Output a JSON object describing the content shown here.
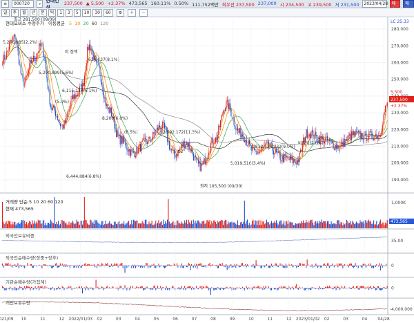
{
  "toolbar": {
    "symbol_code": "000720",
    "stock_name": "현대건설",
    "buy_label": "매수",
    "sell_label": "매도",
    "quotes": [
      {
        "text": "237,500",
        "dir": "up"
      },
      {
        "text": "▲ 5,500",
        "dir": "up"
      },
      {
        "text": "+2.37%",
        "dir": "up"
      },
      {
        "text": "473,565",
        "dir": "nt"
      },
      {
        "text": "160.11%",
        "dir": "nt"
      },
      {
        "text": "0.50%",
        "dir": "nt"
      },
      {
        "text": "111,752백만",
        "dir": "nt"
      },
      {
        "text": "최우선 237,500",
        "dir": "up"
      },
      {
        "text": "237,000",
        "dir": "dn"
      },
      {
        "text": "시 234,500",
        "dir": "up"
      },
      {
        "text": "고 239,500",
        "dir": "up"
      },
      {
        "text": "저 231,500",
        "dir": "dn"
      }
    ],
    "date_value": "2023/04/28",
    "period_buttons": [
      "일",
      "주",
      "월",
      "년",
      "분",
      "틱",
      "1",
      "3",
      "5",
      "10",
      "30",
      "60"
    ]
  },
  "price_pane": {
    "legend_title": "현대모비스 수정주가",
    "ma_label": "이동평균",
    "ma_periods": [
      "5",
      "10",
      "20",
      "60",
      "120"
    ],
    "ma_colors": [
      "#d4a000",
      "#ff7a00",
      "#2aa54a",
      "#333333",
      "#8a8a8a"
    ],
    "annotations": [
      {
        "text": "최고 281,500 (09/09)"
      },
      {
        "text": "5,206,185(2.2%)"
      },
      {
        "text": "비 정액"
      },
      {
        "text": "624,837(8.1%)"
      },
      {
        "text": "5,290,899(5.6%)"
      },
      {
        "text": "6,115,137(6.1%)"
      },
      {
        "text": "(5.9%)"
      },
      {
        "text": "8,200(6.0%)"
      },
      {
        "text": "12,592,172(11.3%)"
      },
      {
        "text": "5,02"
      },
      {
        "text": "(6.5%)"
      },
      {
        "text": "5,019,516(3.4%)"
      },
      {
        "text": "6,444,884(6.8%)"
      },
      {
        "text": "최저 185,500 (09/30)"
      },
      {
        "text": "2,812,124,232(9.9%)"
      },
      {
        "text": "비정액(2.6%)"
      }
    ],
    "current_price": "237,500",
    "current_change": "+2.37%",
    "current_diff": "5,500",
    "top_right_label": "LC 25.33"
  },
  "y_axis_labels": [
    "280,000",
    "270,000",
    "260,000",
    "250,000",
    "240,000",
    "230,000",
    "220,000",
    "210,000",
    "200,000",
    "190,000"
  ],
  "volume_pane": {
    "legend": "거래량 단순 5 10 20 60 120",
    "sub": "현재 473,565",
    "axis_label": "1,000K",
    "current_value": "473,565"
  },
  "foreign_pane": {
    "title": "외국인보유비중",
    "axis_label": "35.00"
  },
  "foreign_net_pane": {
    "title": "외국인순매수량(장중+장후)",
    "axis_label": "0"
  },
  "inst_net_pane": {
    "title": "기관순매수량(가집계)",
    "axis_label": "0"
  },
  "indiv_pane": {
    "title": "개인보유수량",
    "axis_label": "-4,000,000"
  },
  "x_axis_labels": [
    "2021/09",
    "10",
    "11",
    "12",
    "2022/01/03",
    "02",
    "03",
    "04",
    "05",
    "06",
    "07",
    "08",
    "09",
    "10",
    "11",
    "12",
    "2023/01/02",
    "02",
    "03",
    "04",
    "04/28"
  ],
  "colors": {
    "up": "#e0201a",
    "down": "#1b4fcf",
    "shade": "#f3e1c8"
  }
}
